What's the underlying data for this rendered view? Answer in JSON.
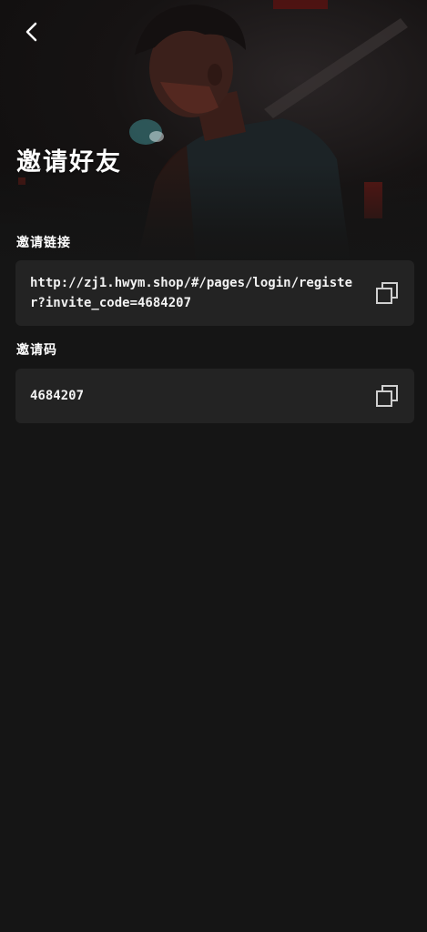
{
  "header": {
    "title": "邀请好友",
    "back_icon": "chevron-left-icon"
  },
  "invite_link": {
    "label": "邀请链接",
    "value": "http://zj1.hwym.shop/#/pages/login/register?invite_code=4684207",
    "copy_icon": "copy-icon"
  },
  "invite_code": {
    "label": "邀请码",
    "value": "4684207",
    "copy_icon": "copy-icon"
  },
  "colors": {
    "background": "#151515",
    "card": "#232323",
    "text": "#ffffff",
    "icon": "#cfcfcf"
  }
}
